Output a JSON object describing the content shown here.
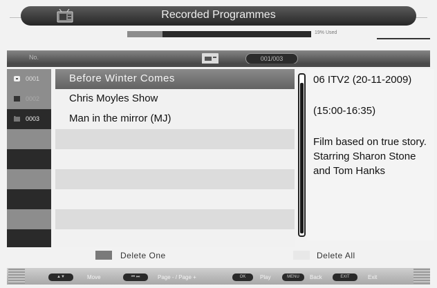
{
  "title": "Recorded Programmes",
  "usage": {
    "percent_used": 19,
    "label": "19% Used"
  },
  "header": {
    "no_label": "No.",
    "counter": "001/003"
  },
  "programmes": [
    {
      "number": "0001",
      "title": "Before Winter Comes",
      "selected": true
    },
    {
      "number": "0002",
      "title": "Chris Moyles Show",
      "selected": false
    },
    {
      "number": "0003",
      "title": "Man in the mirror (MJ)",
      "selected": false
    }
  ],
  "info": {
    "channel_date": "06 ITV2 (20-11-2009)",
    "time": "(15:00-16:35)",
    "description": "Film based on true story. Starring Sharon Stone and Tom Hanks"
  },
  "actions": {
    "delete_one": "Delete One",
    "delete_all": "Delete All",
    "delete_one_color": "#7a7a7a",
    "delete_all_color": "#e8e8e8"
  },
  "hints": {
    "move_key": "▲▼",
    "move_label": "Move",
    "page_key": "⏮ ⏭",
    "page_label": "Page - / Page +",
    "ok_key": "OK",
    "play_label": "Play",
    "menu_key": "MENU",
    "back_label": "Back",
    "exit_key": "EXIT",
    "exit_label": "Exit"
  },
  "colors": {
    "title_bar": "#262626",
    "selected_row": "#707070",
    "usage_fill": "#8c8c8c"
  }
}
